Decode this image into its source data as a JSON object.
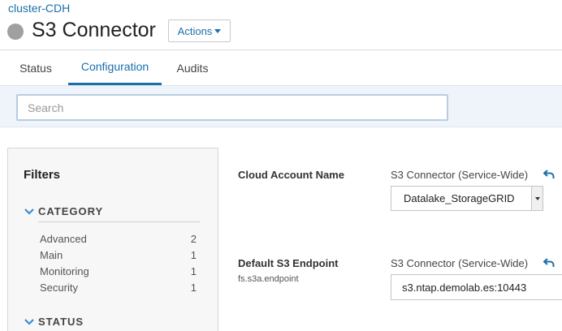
{
  "header": {
    "breadcrumb": "cluster-CDH",
    "title": "S3 Connector",
    "actions_label": "Actions",
    "status_color": "#a0a0a0"
  },
  "tabs": [
    {
      "label": "Status",
      "active": false
    },
    {
      "label": "Configuration",
      "active": true
    },
    {
      "label": "Audits",
      "active": false
    }
  ],
  "search": {
    "placeholder": "Search",
    "value": ""
  },
  "filters": {
    "title": "Filters",
    "category": {
      "heading": "CATEGORY",
      "items": [
        {
          "label": "Advanced",
          "count": "2"
        },
        {
          "label": "Main",
          "count": "1"
        },
        {
          "label": "Monitoring",
          "count": "1"
        },
        {
          "label": "Security",
          "count": "1"
        }
      ]
    },
    "status": {
      "heading": "STATUS"
    }
  },
  "properties": [
    {
      "label": "Cloud Account Name",
      "key": "",
      "scope": "S3 Connector (Service-Wide)",
      "value": "Datalake_StorageGRID",
      "icon": "undo-icon"
    },
    {
      "label": "Default S3 Endpoint",
      "key": "fs.s3a.endpoint",
      "scope": "S3 Connector (Service-Wide)",
      "value": "s3.ntap.demolab.es:10443",
      "icon": "undo-icon"
    }
  ],
  "colors": {
    "accent": "#1a6fa9",
    "search_band": "#eef4fa"
  }
}
